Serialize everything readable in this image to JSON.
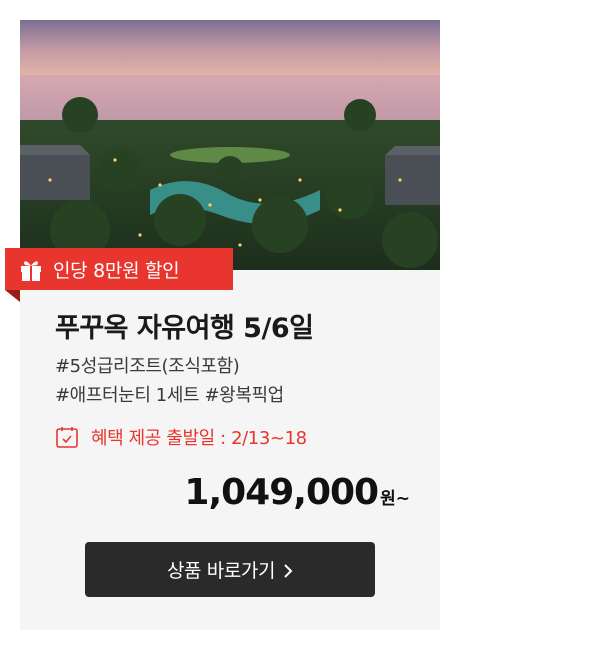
{
  "hero_image": {
    "icon": "resort-beach-photo"
  },
  "badge": {
    "icon": "gift-icon",
    "text": "인당 8만원 할인",
    "color": "#e8362e"
  },
  "title": "푸꾸옥 자유여행 5/6일",
  "tags": [
    "#5성급리조트(조식포함)",
    "#애프터눈티 1세트 #왕복픽업"
  ],
  "benefit": {
    "icon": "calendar-check-icon",
    "text": "혜택 제공 출발일 : 2/13~18",
    "color": "#e8362e"
  },
  "price": {
    "amount": "1,049,000",
    "unit": "원~"
  },
  "cta": {
    "label": "상품 바로가기",
    "icon": "chevron-right-icon"
  }
}
